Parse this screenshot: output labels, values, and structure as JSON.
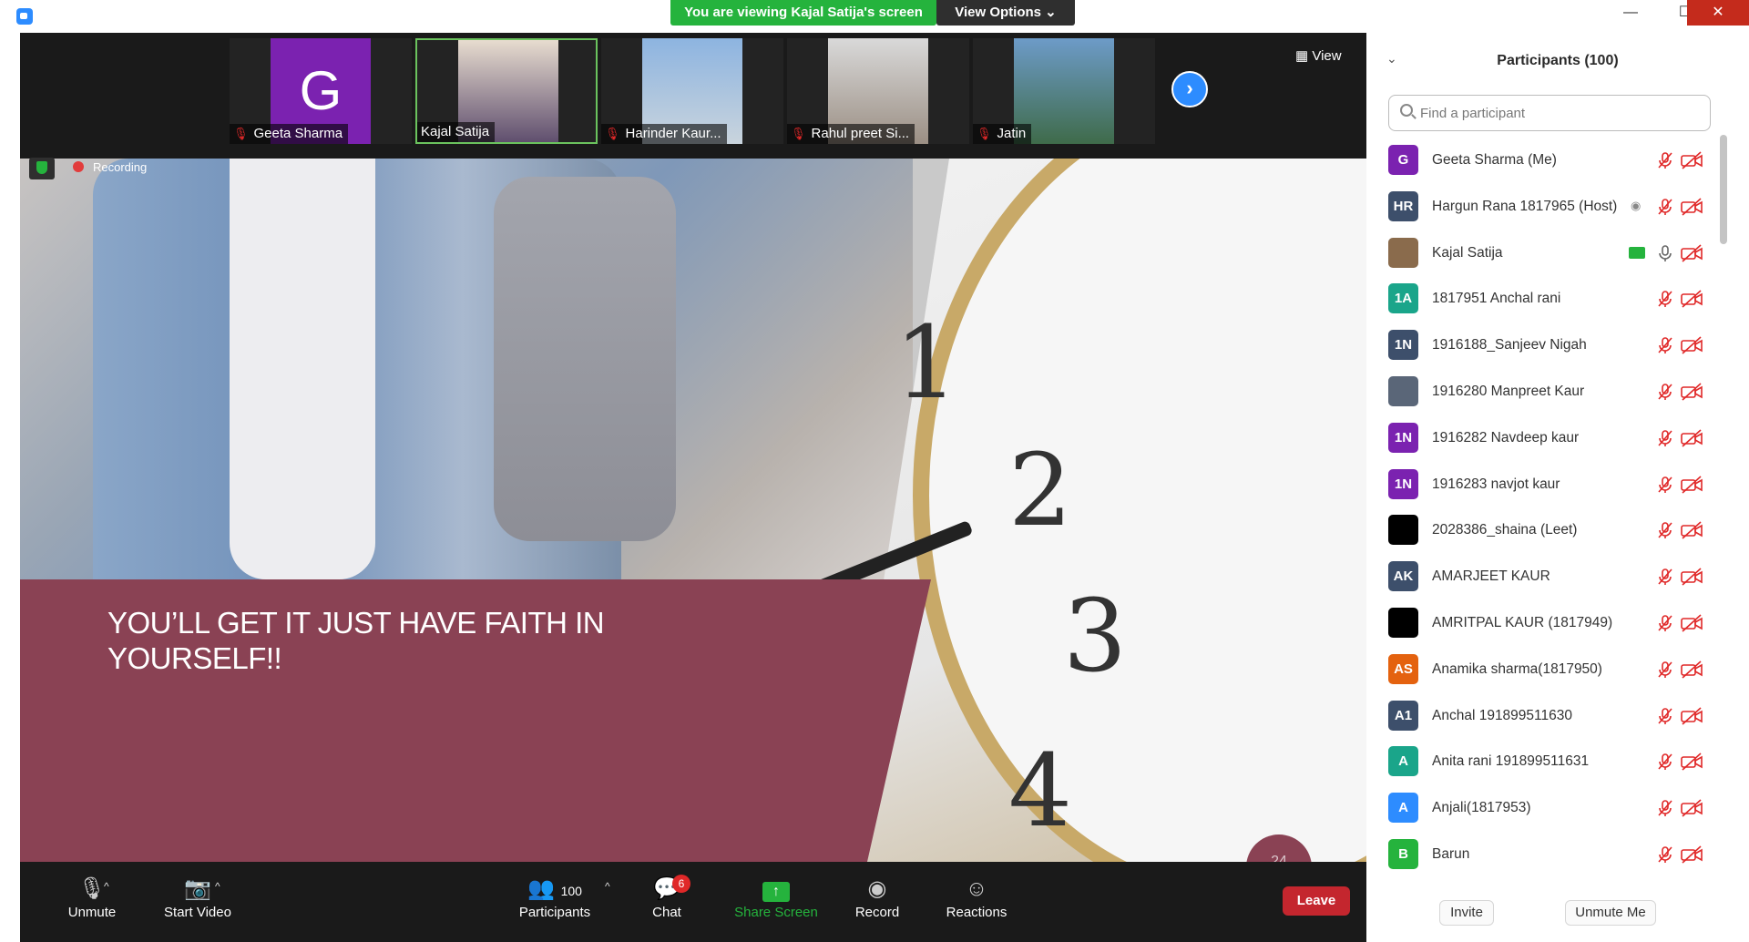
{
  "banner": {
    "viewing": "You are viewing Kajal Satija's screen",
    "view_options": "View Options ⌄"
  },
  "window": {
    "minimize": "—",
    "maximize": "☐",
    "close": "✕"
  },
  "video_strip": {
    "view_label": "View",
    "tiles": [
      {
        "name": "Geeta Sharma",
        "initial": "G",
        "muted": true,
        "color": "#7b22b0"
      },
      {
        "name": "Kajal Satija",
        "muted": false,
        "active": true
      },
      {
        "name": "Harinder Kaur...",
        "muted": true
      },
      {
        "name": "Rahul preet Si...",
        "muted": true
      },
      {
        "name": "Jatin",
        "muted": true
      }
    ]
  },
  "share": {
    "quote": "YOU’LL GET IT JUST HAVE FAITH IN YOURSELF!!",
    "page_number": "24",
    "recording_label": "Recording",
    "clock_numbers": [
      "1",
      "2",
      "3",
      "4"
    ]
  },
  "toolbar": {
    "unmute": "Unmute",
    "start_video": "Start Video",
    "participants": "Participants",
    "participants_count": "100",
    "chat": "Chat",
    "chat_badge": "6",
    "share_screen": "Share Screen",
    "record": "Record",
    "reactions": "Reactions",
    "leave": "Leave"
  },
  "panel": {
    "title": "Participants (100)",
    "search_placeholder": "Find a participant",
    "participants": [
      {
        "initials": "G",
        "name": "Geeta Sharma (Me)",
        "color": "#7b22b0"
      },
      {
        "initials": "HR",
        "name": "Hargun Rana 1817965 (Host)",
        "color": "#3d4f6b"
      },
      {
        "initials": "",
        "name": "Kajal Satija",
        "color": "#8a6b4c"
      },
      {
        "initials": "1A",
        "name": "1817951 Anchal rani",
        "color": "#1aa58a"
      },
      {
        "initials": "1N",
        "name": "1916188_Sanjeev Nigah",
        "color": "#3d4f6b"
      },
      {
        "initials": "",
        "name": "1916280 Manpreet Kaur",
        "color": "#5a6678"
      },
      {
        "initials": "1N",
        "name": "1916282 Navdeep kaur",
        "color": "#7b22b0"
      },
      {
        "initials": "1N",
        "name": "1916283 navjot kaur",
        "color": "#7b22b0"
      },
      {
        "initials": "",
        "name": "2028386_shaina (Leet)",
        "color": "#000000"
      },
      {
        "initials": "AK",
        "name": "AMARJEET KAUR",
        "color": "#3d4f6b"
      },
      {
        "initials": "",
        "name": "AMRITPAL KAUR (1817949)",
        "color": "#000000"
      },
      {
        "initials": "AS",
        "name": "Anamika sharma(1817950)",
        "color": "#e4620f"
      },
      {
        "initials": "A1",
        "name": "Anchal 191899511630",
        "color": "#3d4f6b"
      },
      {
        "initials": "A",
        "name": "Anita rani 191899511631",
        "color": "#1aa58a"
      },
      {
        "initials": "A",
        "name": "Anjali(1817953)",
        "color": "#2d8cff"
      },
      {
        "initials": "B",
        "name": "Barun",
        "color": "#25b33d"
      }
    ],
    "invite": "Invite",
    "unmute_me": "Unmute Me"
  }
}
